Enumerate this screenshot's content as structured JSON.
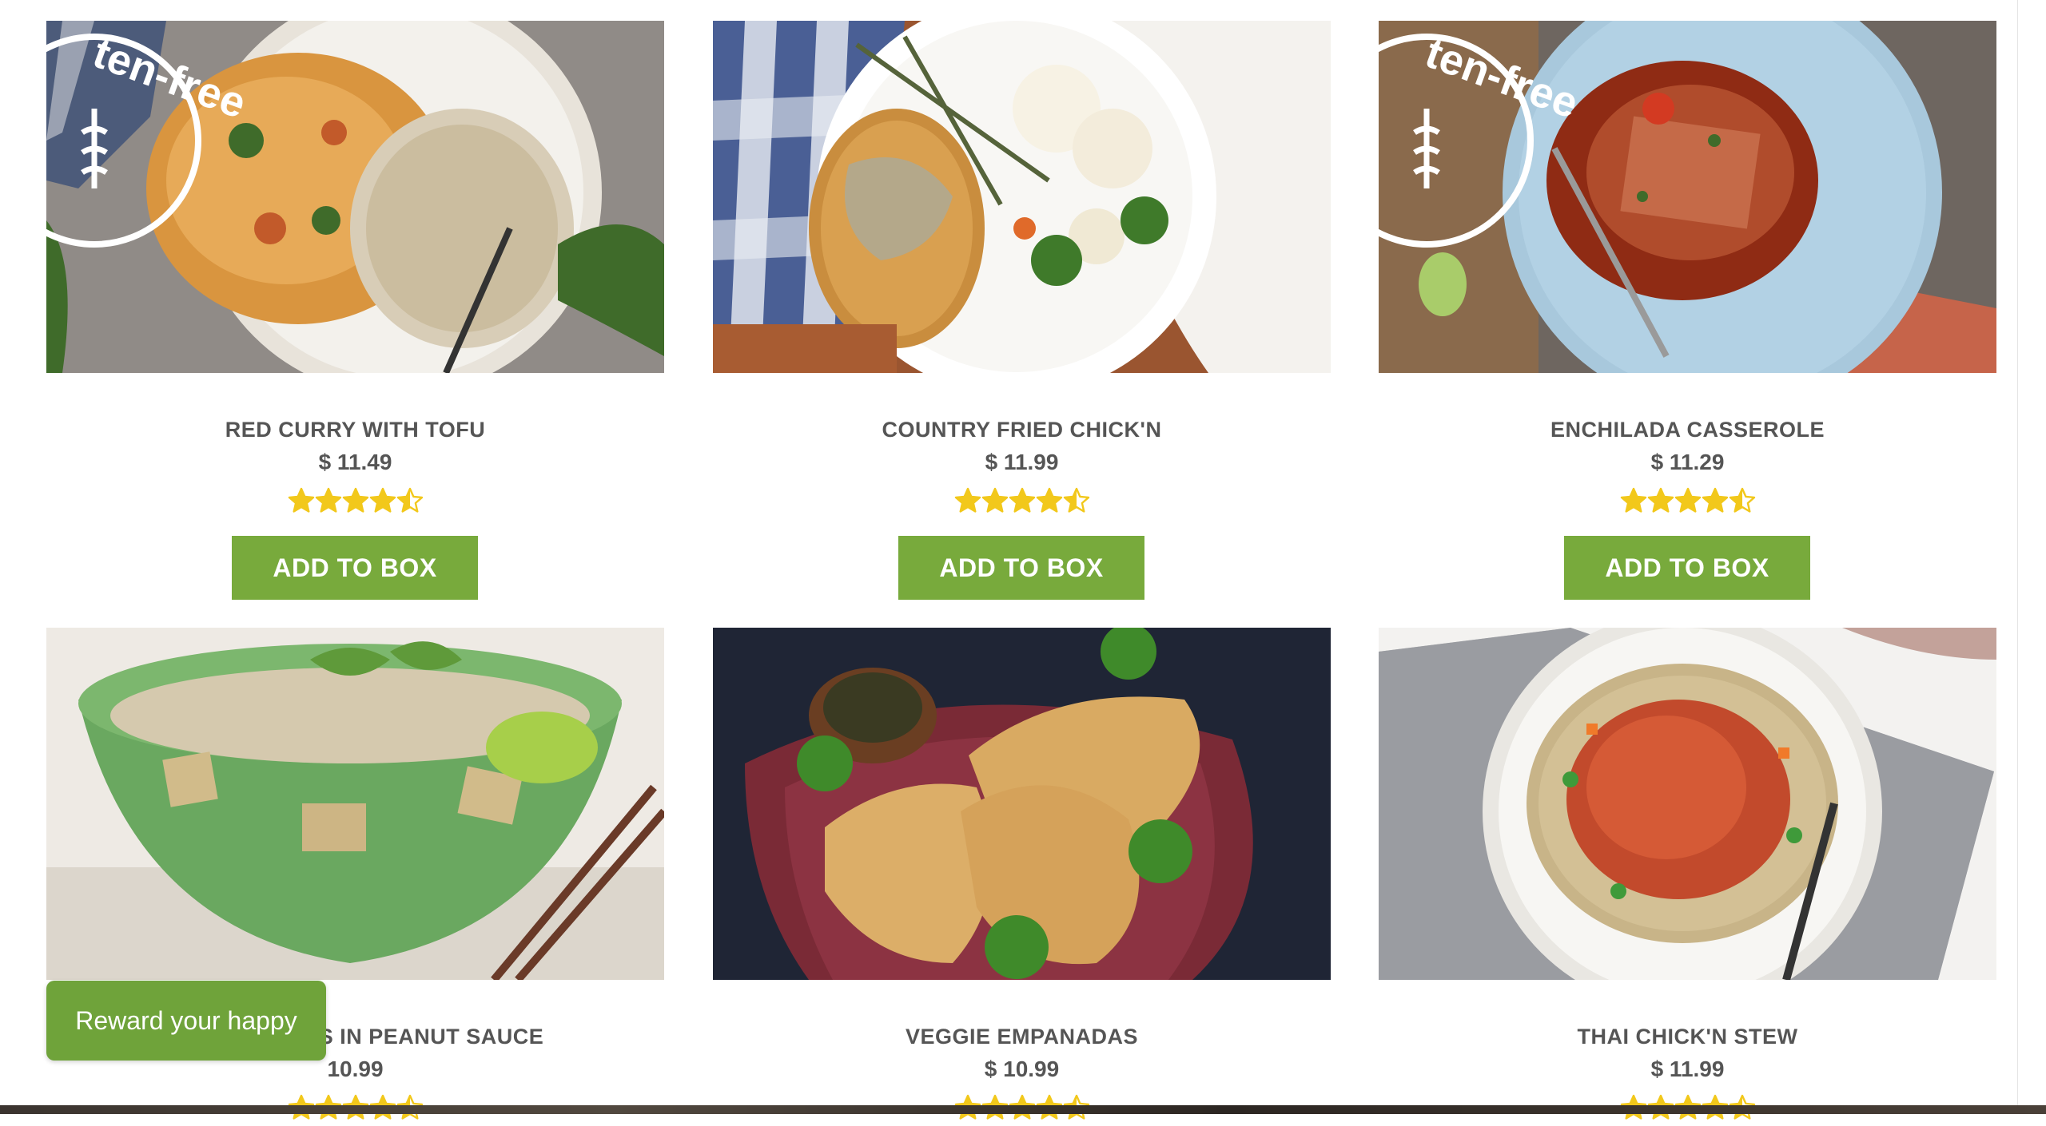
{
  "products": [
    {
      "title": "RED CURRY WITH TOFU",
      "price": "$ 11.49",
      "rating": 4.5,
      "button": "ADD TO BOX",
      "image_badge": "gluten-free"
    },
    {
      "title": "COUNTRY FRIED CHICK'N",
      "price": "$ 11.99",
      "rating": 4.5,
      "button": "ADD TO BOX"
    },
    {
      "title": "ENCHILADA CASSEROLE",
      "price": "$ 11.29",
      "rating": 4.5,
      "button": "ADD TO BOX",
      "image_badge": "gluten-free"
    },
    {
      "title": "S IN PEANUT SAUCE",
      "price": "10.99",
      "rating": 4.5
    },
    {
      "title": "VEGGIE EMPANADAS",
      "price": "$ 10.99",
      "rating": 4.5
    },
    {
      "title": "THAI CHICK'N STEW",
      "price": "$ 11.99",
      "rating": 4.5
    }
  ],
  "reward_widget": {
    "label": "Reward your happy"
  },
  "colors": {
    "accent_green": "#78aa3c",
    "star_yellow": "#f2c81b",
    "text_gray": "#555555"
  }
}
